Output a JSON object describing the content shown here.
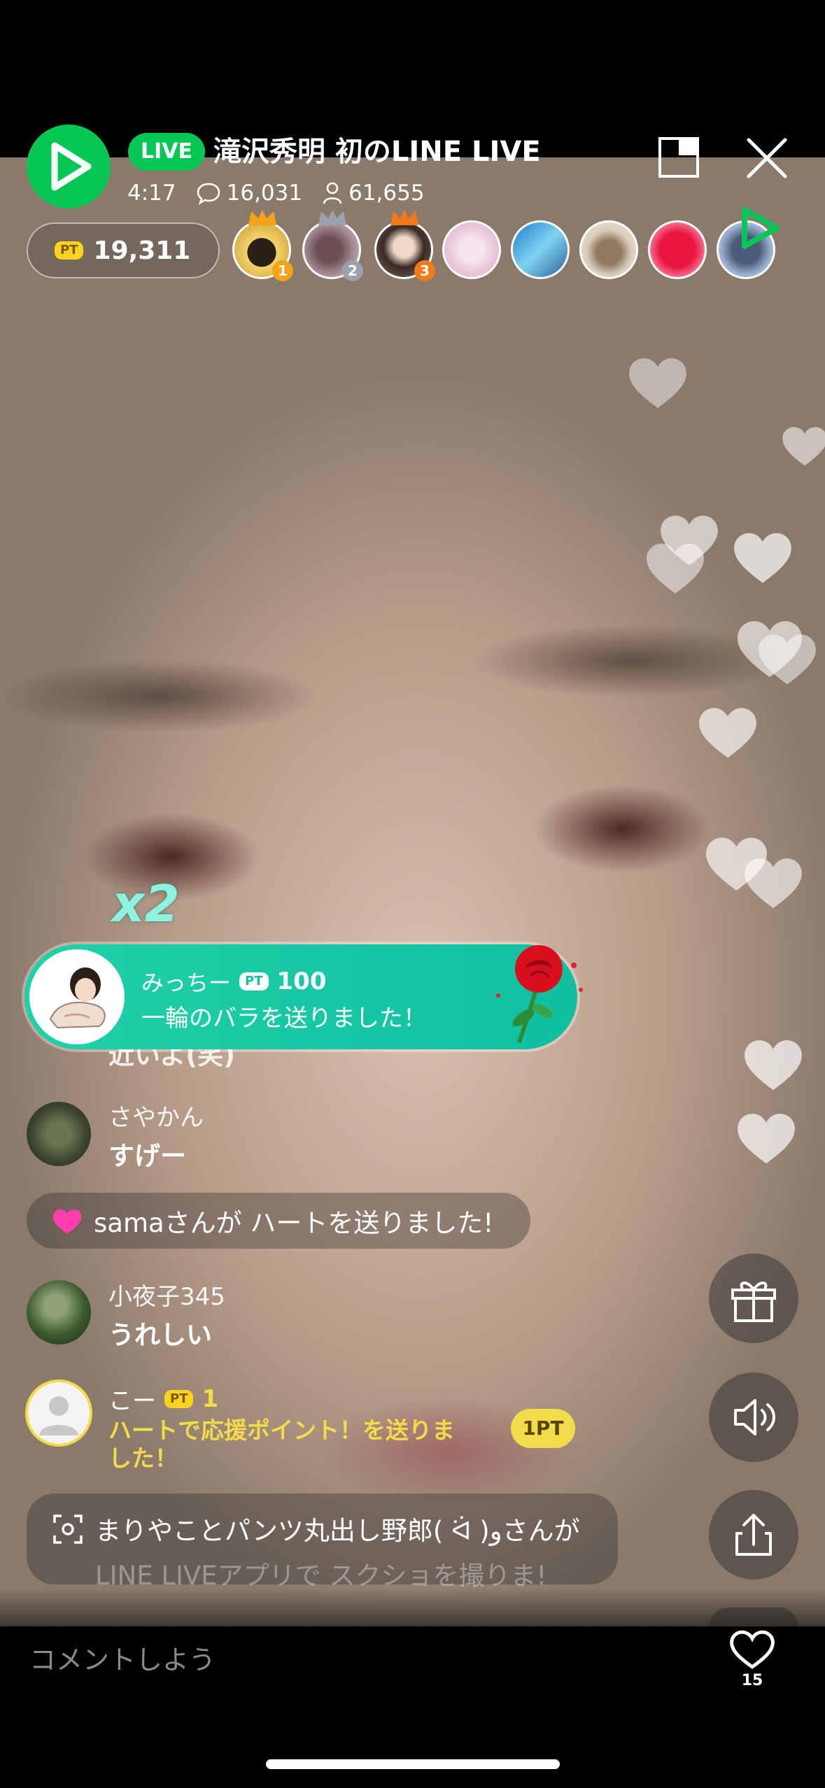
{
  "header": {
    "live_label": "LIVE",
    "title": "滝沢秀明 初のLINE LIVE",
    "elapsed_time": "4:17",
    "comment_count": "16,031",
    "viewer_count": "61,655"
  },
  "points": {
    "badge": "PT",
    "total": "19,311"
  },
  "top_viewers": [
    {
      "rank": "1",
      "color": "#f5a21b"
    },
    {
      "rank": "2",
      "color": "#9aa3ad"
    },
    {
      "rank": "3",
      "color": "#f07a1a"
    }
  ],
  "effects": {
    "combo": "x2"
  },
  "gift": {
    "user": "みっちー",
    "badge": "PT",
    "points": "100",
    "message": "一輪のバラを送りました！"
  },
  "chat": {
    "cut_text": "近いよ(笑)",
    "messages": [
      {
        "name": "さやかん",
        "text": "すげー"
      },
      {
        "name": "小夜子345",
        "text": "うれしい"
      }
    ],
    "heart_notice": "samaさんが ハートを送りました!",
    "support": {
      "name": "こー",
      "badge": "PT",
      "points": "1",
      "text_line1": "ハートで応援ポイント！を送りま",
      "text_line2": "した！",
      "point_tag": "1PT"
    },
    "screenshot_notice_line1": "まりやことパンツ丸出し野郎( ᐛ )وさんが",
    "screenshot_notice_line2": "LINE LIVEアプリで スクショを撮りま!"
  },
  "footer": {
    "comment_placeholder": "コメントしよう",
    "like_count": "15"
  },
  "colors": {
    "line_green": "#06c755",
    "gift_teal": "#1fd1a8",
    "point_yellow": "#ffd21e",
    "support_text": "#f2dc4a"
  }
}
